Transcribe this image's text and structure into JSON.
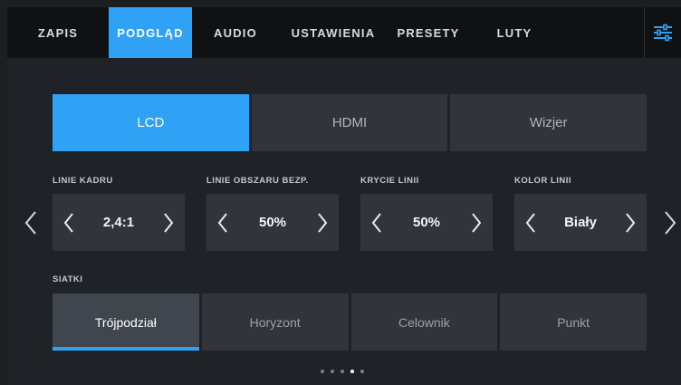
{
  "tabs": [
    {
      "label": "ZAPIS",
      "active": false
    },
    {
      "label": "PODGLĄD",
      "active": true
    },
    {
      "label": "AUDIO",
      "active": false
    },
    {
      "label": "USTAWIENIA",
      "active": false
    },
    {
      "label": "PRESETY",
      "active": false
    },
    {
      "label": "LUTY",
      "active": false
    }
  ],
  "output": {
    "options": [
      "LCD",
      "HDMI",
      "Wizjer"
    ],
    "selected": "LCD"
  },
  "settings": [
    {
      "label": "LINIE KADRU",
      "value": "2,4:1"
    },
    {
      "label": "LINIE OBSZARU BEZP.",
      "value": "50%"
    },
    {
      "label": "KRYCIE LINII",
      "value": "50%"
    },
    {
      "label": "KOLOR LINII",
      "value": "Biały"
    }
  ],
  "grids": {
    "label": "SIATKI",
    "options": [
      "Trójpodział",
      "Horyzont",
      "Celownik",
      "Punkt"
    ],
    "selected": "Trójpodział"
  },
  "pagination": {
    "total": 5,
    "current": 4
  },
  "icons": {
    "menu": "sliders-icon",
    "prev": "chevron-left-icon",
    "next": "chevron-right-icon"
  },
  "colors": {
    "accent": "#2fa2f5",
    "background": "#1c1e22",
    "tile": "#31353b"
  }
}
